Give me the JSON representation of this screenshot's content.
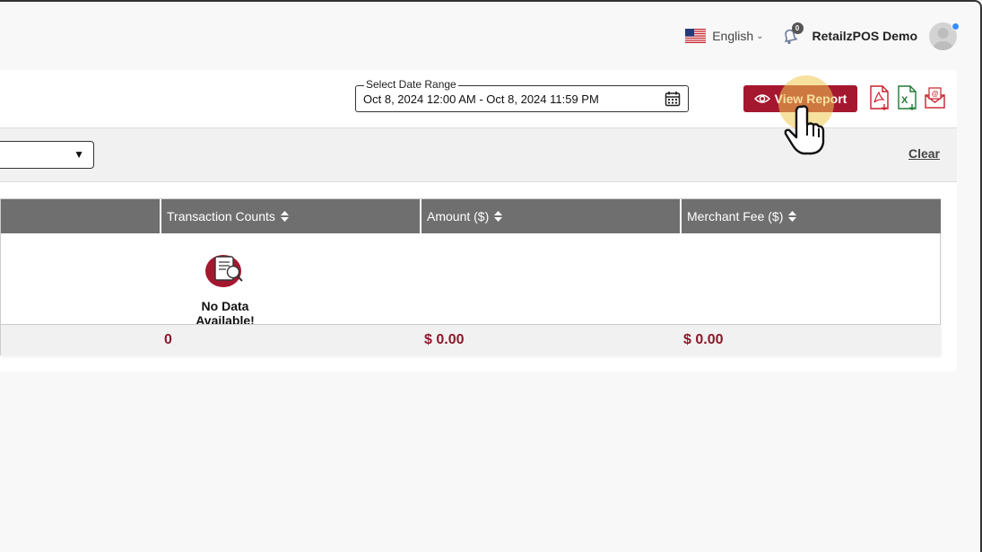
{
  "header": {
    "language": "English",
    "notification_count": "0",
    "user_name": "RetailzPOS Demo"
  },
  "report": {
    "date_range_label": "Select Date Range",
    "date_range_value": "Oct 8, 2024 12:00 AM - Oct 8, 2024 11:59 PM",
    "view_button": "View Report",
    "clear_label": "Clear"
  },
  "table": {
    "columns": [
      "Transaction Counts",
      "Amount ($)",
      "Merchant Fee ($)"
    ],
    "empty_text": "No Data Available!",
    "totals": [
      "0",
      "$ 0.00",
      "$ 0.00"
    ]
  },
  "colors": {
    "accent": "#a5172f",
    "header_gray": "#6f6f6f",
    "total_text": "#8b1a2c",
    "notification_dot": "#3a8bff"
  },
  "icons": [
    "flag-us-icon",
    "chevron-down-icon",
    "bell-icon",
    "calendar-icon",
    "eye-icon",
    "pdf-icon",
    "excel-icon",
    "email-icon",
    "sort-icon",
    "no-data-icon",
    "hand-cursor-icon"
  ]
}
